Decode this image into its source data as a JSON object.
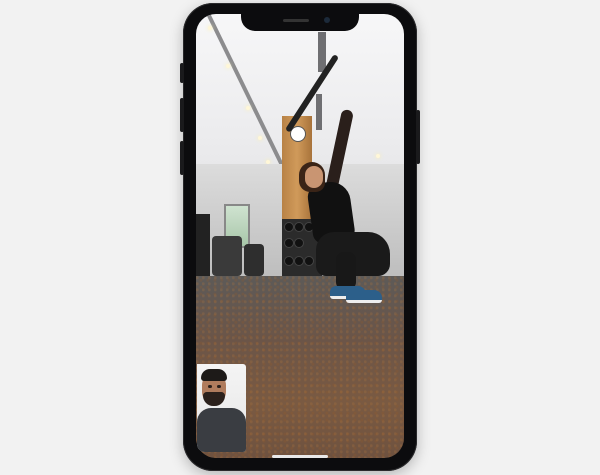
{
  "device": {
    "model": "smartphone",
    "frame_color": "#0c0c0e"
  },
  "call": {
    "type": "video-call",
    "remote_video": {
      "scene": "",
      "accent": "#c2864a"
    },
    "self_view": {
      "position": "bottom-left"
    }
  },
  "colors": {
    "background": "#f2f2f2",
    "floor": "#6e5240",
    "ceiling": "#ececee"
  }
}
